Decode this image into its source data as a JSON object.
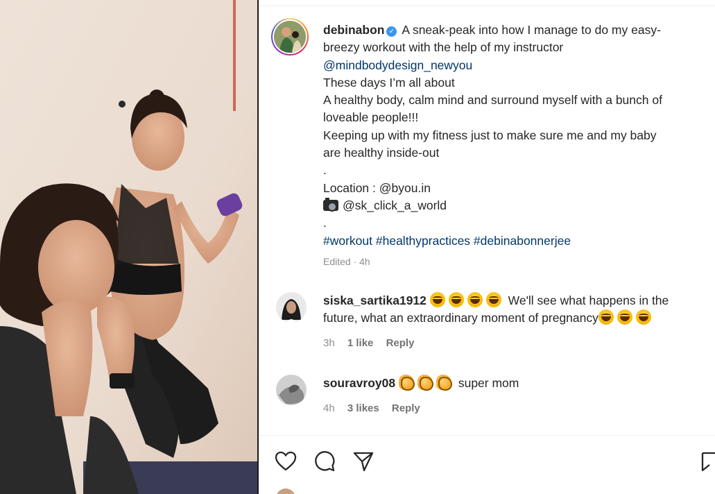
{
  "post": {
    "username": "debinabon",
    "verified_mark": "✓",
    "caption_lines": [
      "A sneak-peak into how I manage to do my easy-",
      "breezy workout with the help of my instructor",
      "@mindbodydesign_newyou",
      "These days I’m all about",
      "A healthy body, calm mind and surround myself with a bunch of",
      "loveable people!!!",
      "Keeping up with my fitness just to make sure me and my baby",
      "are healthy inside-out",
      ".",
      "Location : @byou.in",
      "@sk_click_a_world",
      ".",
      "#workout #healthypractices #debinabonnerjee"
    ],
    "edited": "Edited · 4h"
  },
  "comments": [
    {
      "username": "siska_sartika1912",
      "text_line1": "We'll see what happens in the",
      "text_line2": "future, what an extraordinary moment of pregnancy",
      "time": "3h",
      "likes": "1 like",
      "reply": "Reply"
    },
    {
      "username": "souravroy08",
      "text": "super mom",
      "time": "4h",
      "likes": "3 likes",
      "reply": "Reply"
    }
  ],
  "icons": [
    "heart-icon",
    "comment-icon",
    "share-icon",
    "bookmark-icon",
    "verified-icon",
    "camera-icon"
  ],
  "colors": {
    "link": "#00376b",
    "verified": "#3897f0",
    "meta": "#8e8e8e",
    "text": "#262626"
  }
}
